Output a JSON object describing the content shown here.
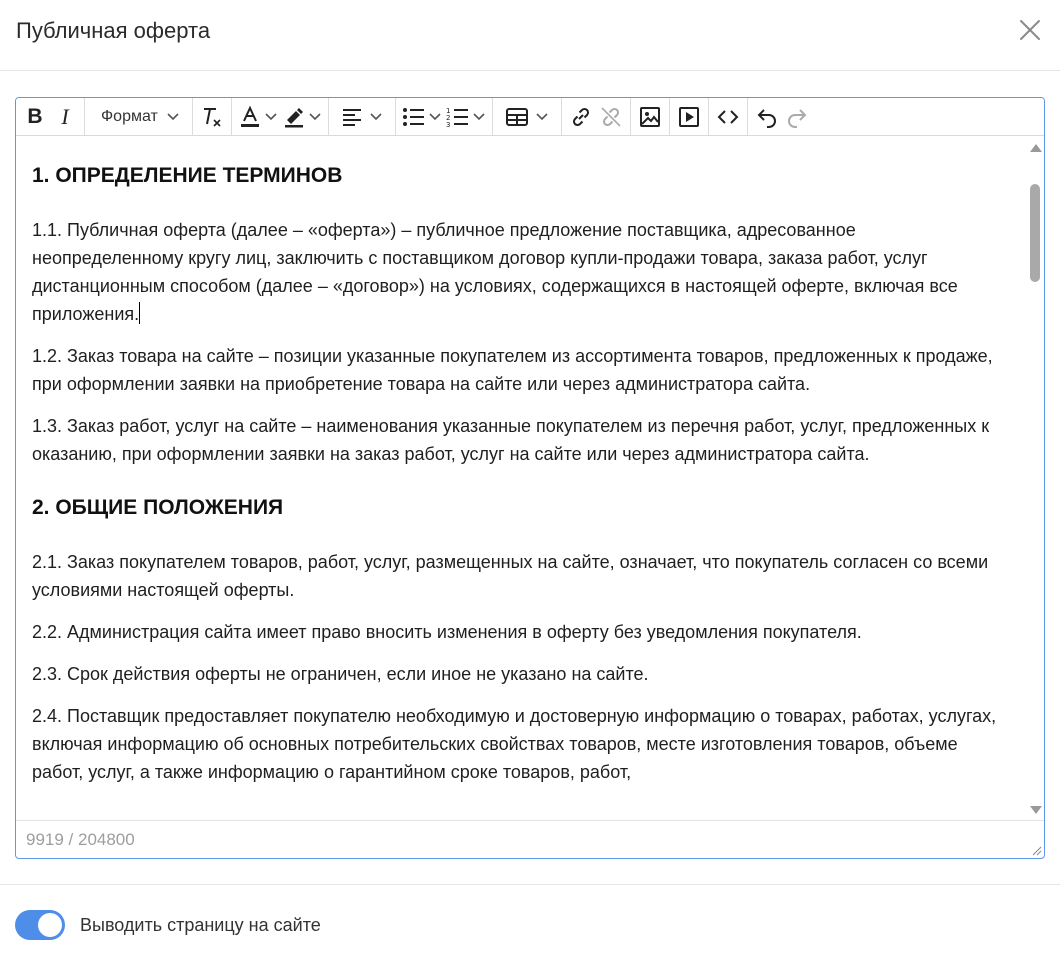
{
  "modal": {
    "title": "Публичная оферта"
  },
  "toolbar": {
    "bold": "B",
    "italic": "I",
    "format_label": "Формат"
  },
  "content": {
    "heading1": "1. ОПРЕДЕЛЕНИЕ ТЕРМИНОВ",
    "p1_1": "1.1. Публичная оферта (далее – «оферта») – публичное предложение поставщика, адресованное неопределенному кругу лиц, заключить с поставщиком договор купли-продажи товара, заказа работ, услуг дистанционным способом (далее – «договор») на условиях, содержащихся в настоящей оферте, включая все приложения.",
    "p1_2": "1.2. Заказ товара на сайте – позиции указанные покупателем из ассортимента товаров, предложенных к продаже, при оформлении заявки на приобретение товара на сайте или через администратора сайта.",
    "p1_3": "1.3. Заказ работ, услуг на сайте – наименования указанные покупателем из перечня работ, услуг, предложенных к оказанию, при оформлении заявки на заказ работ, услуг на сайте или через администратора сайта.",
    "heading2": "2. ОБЩИЕ ПОЛОЖЕНИЯ",
    "p2_1": "2.1. Заказ покупателем товаров, работ, услуг, размещенных на сайте, означает, что покупатель согласен со всеми условиями настоящей оферты.",
    "p2_2": "2.2. Администрация сайта имеет право вносить изменения в оферту без уведомления покупателя.",
    "p2_3": "2.3. Срок действия оферты не ограничен, если иное не указано на сайте.",
    "p2_4": "2.4. Поставщик предоставляет покупателю необходимую и достоверную информацию о товарах, работах, услугах, включая информацию об основных потребительских свойствах товаров, месте изготовления товаров, объеме работ, услуг, а также информацию о гарантийном сроке товаров, работ,"
  },
  "status": {
    "char_count": "9919 / 204800"
  },
  "footer": {
    "toggle_label": "Выводить страницу на сайте",
    "toggle_on": true,
    "toggle_color": "#4f8ee8"
  },
  "colors": {
    "editor_border": "#5b9ae8",
    "accent": "#4f8ee8"
  }
}
